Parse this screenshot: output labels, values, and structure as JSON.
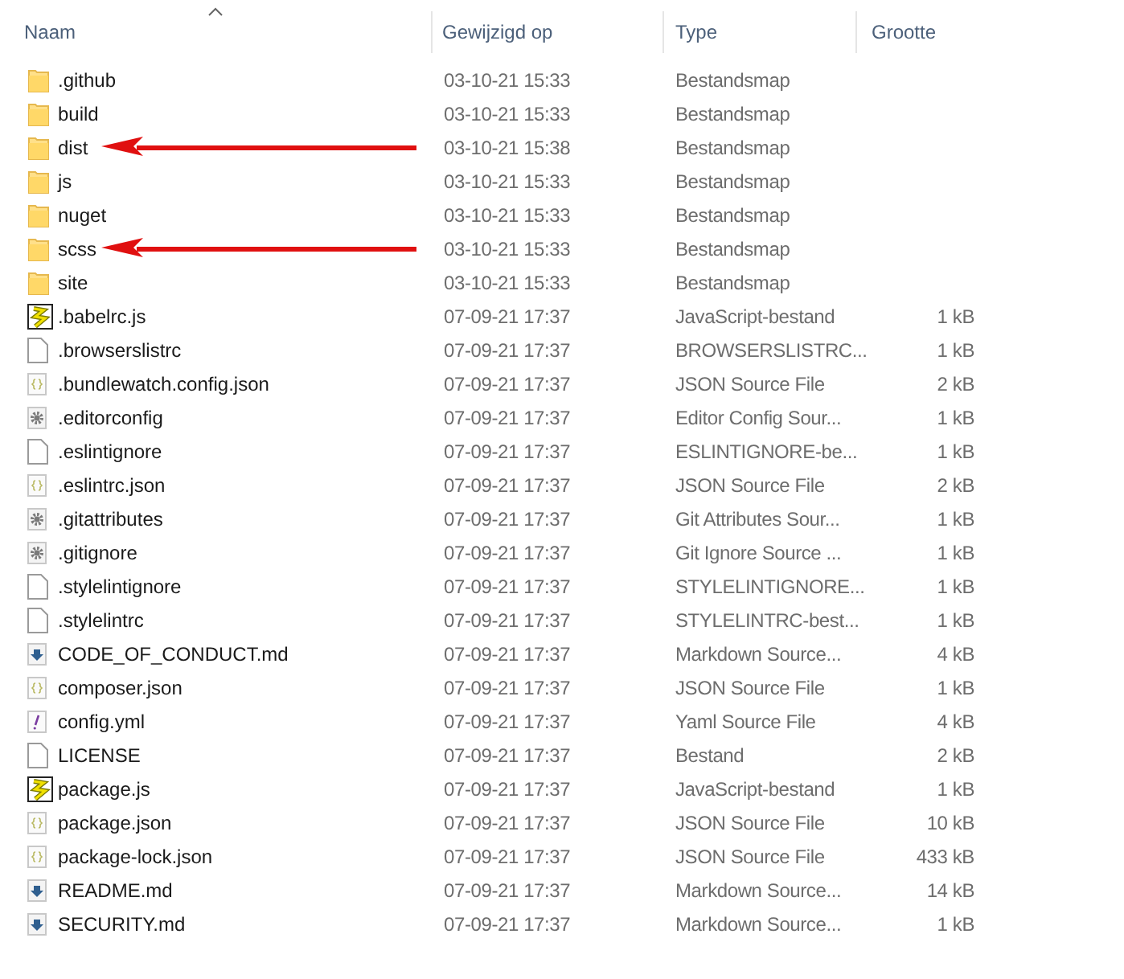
{
  "columns": [
    {
      "label": "Naam",
      "sorted": true
    },
    {
      "label": "Gewijzigd op",
      "sorted": false
    },
    {
      "label": "Type",
      "sorted": false
    },
    {
      "label": "Grootte",
      "sorted": false
    }
  ],
  "rows": [
    {
      "kind": "folder",
      "name": ".github",
      "modified": "03-10-21 15:33",
      "type": "Bestandsmap",
      "marked": false
    },
    {
      "kind": "folder",
      "name": "build",
      "modified": "03-10-21 15:33",
      "type": "Bestandsmap",
      "marked": false
    },
    {
      "kind": "folder",
      "name": "dist",
      "modified": "03-10-21 15:38",
      "type": "Bestandsmap",
      "marked": true
    },
    {
      "kind": "folder",
      "name": "js",
      "modified": "03-10-21 15:33",
      "type": "Bestandsmap",
      "marked": false
    },
    {
      "kind": "folder",
      "name": "nuget",
      "modified": "03-10-21 15:33",
      "type": "Bestandsmap",
      "marked": false
    },
    {
      "kind": "folder",
      "name": "scss",
      "modified": "03-10-21 15:33",
      "type": "Bestandsmap",
      "marked": true
    },
    {
      "kind": "folder",
      "name": "site",
      "modified": "03-10-21 15:33",
      "type": "Bestandsmap",
      "marked": false
    },
    {
      "kind": "js",
      "name": ".babelrc.js",
      "modified": "07-09-21 17:37",
      "type": "JavaScript-bestand",
      "size": "1 kB",
      "marked": false
    },
    {
      "kind": "file",
      "name": ".browserslistrc",
      "modified": "07-09-21 17:37",
      "type": "BROWSERSLISTRC...",
      "size": "1 kB",
      "marked": false
    },
    {
      "kind": "json",
      "name": ".bundlewatch.config.json",
      "modified": "07-09-21 17:37",
      "type": "JSON Source File",
      "size": "2 kB",
      "marked": false
    },
    {
      "kind": "gear",
      "name": ".editorconfig",
      "modified": "07-09-21 17:37",
      "type": "Editor Config Sour...",
      "size": "1 kB",
      "marked": false
    },
    {
      "kind": "file",
      "name": ".eslintignore",
      "modified": "07-09-21 17:37",
      "type": "ESLINTIGNORE-be...",
      "size": "1 kB",
      "marked": false
    },
    {
      "kind": "json",
      "name": ".eslintrc.json",
      "modified": "07-09-21 17:37",
      "type": "JSON Source File",
      "size": "2 kB",
      "marked": false
    },
    {
      "kind": "gear",
      "name": ".gitattributes",
      "modified": "07-09-21 17:37",
      "type": "Git Attributes Sour...",
      "size": "1 kB",
      "marked": false
    },
    {
      "kind": "gear",
      "name": ".gitignore",
      "modified": "07-09-21 17:37",
      "type": "Git Ignore Source ...",
      "size": "1 kB",
      "marked": false
    },
    {
      "kind": "file",
      "name": ".stylelintignore",
      "modified": "07-09-21 17:37",
      "type": "STYLELINTIGNORE...",
      "size": "1 kB",
      "marked": false
    },
    {
      "kind": "file",
      "name": ".stylelintrc",
      "modified": "07-09-21 17:37",
      "type": "STYLELINTRC-best...",
      "size": "1 kB",
      "marked": false
    },
    {
      "kind": "md",
      "name": "CODE_OF_CONDUCT.md",
      "modified": "07-09-21 17:37",
      "type": "Markdown Source...",
      "size": "4 kB",
      "marked": false
    },
    {
      "kind": "json",
      "name": "composer.json",
      "modified": "07-09-21 17:37",
      "type": "JSON Source File",
      "size": "1 kB",
      "marked": false
    },
    {
      "kind": "yml",
      "name": "config.yml",
      "modified": "07-09-21 17:37",
      "type": "Yaml Source File",
      "size": "4 kB",
      "marked": false
    },
    {
      "kind": "file",
      "name": "LICENSE",
      "modified": "07-09-21 17:37",
      "type": "Bestand",
      "size": "2 kB",
      "marked": false
    },
    {
      "kind": "js",
      "name": "package.js",
      "modified": "07-09-21 17:37",
      "type": "JavaScript-bestand",
      "size": "1 kB",
      "marked": false
    },
    {
      "kind": "json",
      "name": "package.json",
      "modified": "07-09-21 17:37",
      "type": "JSON Source File",
      "size": "10 kB",
      "marked": false
    },
    {
      "kind": "json",
      "name": "package-lock.json",
      "modified": "07-09-21 17:37",
      "type": "JSON Source File",
      "size": "433 kB",
      "marked": false
    },
    {
      "kind": "md",
      "name": "README.md",
      "modified": "07-09-21 17:37",
      "type": "Markdown Source...",
      "size": "14 kB",
      "marked": false
    },
    {
      "kind": "md",
      "name": "SECURITY.md",
      "modified": "07-09-21 17:37",
      "type": "Markdown Source...",
      "size": "1 kB",
      "marked": false
    }
  ]
}
